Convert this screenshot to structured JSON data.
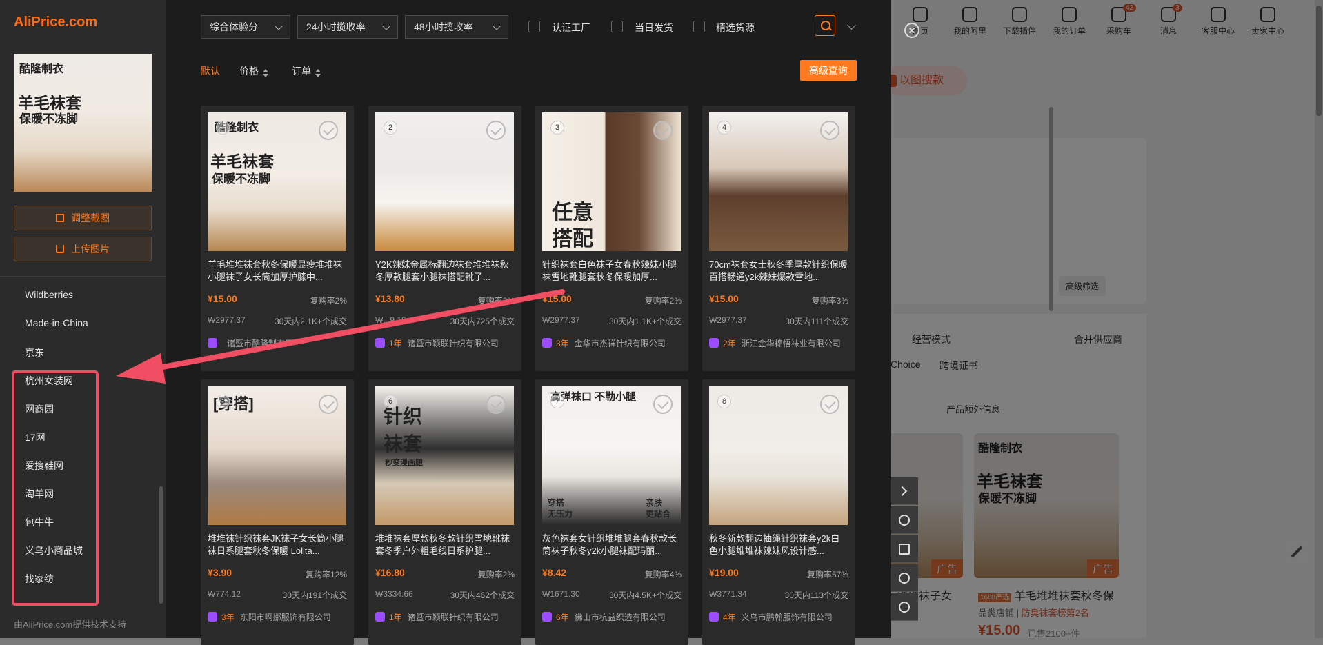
{
  "background": {
    "nav": [
      {
        "label": "首页",
        "badge": ""
      },
      {
        "label": "我的阿里",
        "badge": ""
      },
      {
        "label": "下载插件",
        "badge": ""
      },
      {
        "label": "我的订单",
        "badge": ""
      },
      {
        "label": "采购车",
        "badge": "42"
      },
      {
        "label": "消息",
        "badge": "3"
      },
      {
        "label": "客服中心",
        "badge": ""
      },
      {
        "label": "卖家中心",
        "badge": ""
      }
    ],
    "image_search_label": "以图搜款",
    "advanced_filter_label": "高级筛选",
    "business_mode_label": "经营模式",
    "merge_supplier_label": "合并供应商",
    "choice_label": "Choice",
    "cross_border_label": "跨境证书",
    "extra_info_label": "产品额外信息",
    "card1_title": "堆堆袜子女",
    "card2_badge": "1688严选",
    "card2_title": "羊毛堆堆袜套秋冬保",
    "card2_store": "品类店铺",
    "card2_rank": "防臭袜套榜第2名",
    "card2_price": "¥15.00",
    "card2_sold": "已售2100+件",
    "ad_label": "广告",
    "card2_img_text1": "酷隆制衣",
    "card2_img_text2": "羊毛袜套",
    "card2_img_text3": "保暖不冻脚"
  },
  "sidebar": {
    "logo": "AliPrice.com",
    "thumb_text1": "酷隆制衣",
    "thumb_text2": "羊毛袜套",
    "thumb_text3": "保暖不冻脚",
    "adjust_crop": "调整截图",
    "upload_image": "上传图片",
    "platforms": [
      "Wildberries",
      "Made-in-China",
      "京东",
      "杭州女装网",
      "网商园",
      "17网",
      "爱搜鞋网",
      "淘羊网",
      "包牛牛",
      "义乌小商品城",
      "找家纺"
    ],
    "footer": "由AliPrice.com提供技术支持"
  },
  "filters": {
    "select1": "综合体验分",
    "select2": "24小时揽收率",
    "select3": "48小时揽收率",
    "check1": "认证工厂",
    "check2": "当日发货",
    "check3": "精选货源"
  },
  "sort": {
    "default": "默认",
    "price": "价格",
    "orders": "订单",
    "advanced_query": "高级查询"
  },
  "products": [
    {
      "num": "1",
      "title": "羊毛堆堆袜套秋冬保暖显瘦堆堆袜小腿袜子女长筒加厚护膝中...",
      "price": "¥15.00",
      "repurchase": "复购率2%",
      "gmv": "₩2977.37",
      "deals": "30天内2.1K+个成交",
      "years": "",
      "supplier": "诸暨市酷隆制衣厂",
      "img_text": [
        "酷隆制衣",
        "羊毛袜套",
        "保暖不冻脚"
      ]
    },
    {
      "num": "2",
      "title": "Y2K辣妹金属标翻边袜套堆堆袜秋冬厚款腿套小腿袜搭配靴子...",
      "price": "¥13.80",
      "repurchase": "复购率2%",
      "gmv": "₩...9.18",
      "deals": "30天内725个成交",
      "years": "1年",
      "supplier": "诸暨市颖联针织有限公司",
      "img_text": []
    },
    {
      "num": "3",
      "title": "针织袜套白色袜子女春秋辣妹小腿袜雪地靴腿套秋冬保暖加厚...",
      "price": "¥15.00",
      "repurchase": "复购率2%",
      "gmv": "₩2977.37",
      "deals": "30天内1.1K+个成交",
      "years": "3年",
      "supplier": "金华市杰祥针织有限公司",
      "img_text": [
        "任意",
        "搭配"
      ]
    },
    {
      "num": "4",
      "title": "70cm袜套女士秋冬季厚款针织保暖百搭畅通y2k辣妹爆款雪地...",
      "price": "¥15.00",
      "repurchase": "复购率3%",
      "gmv": "₩2977.37",
      "deals": "30天内111个成交",
      "years": "2年",
      "supplier": "浙江金华棉悟袜业有限公司",
      "img_text": []
    },
    {
      "num": "5",
      "title": "堆堆袜针织袜套JK袜子女长筒小腿袜日系腿套秋冬保暖 Lolita...",
      "price": "¥3.90",
      "repurchase": "复购率12%",
      "gmv": "₩774.12",
      "deals": "30天内191个成交",
      "years": "3年",
      "supplier": "东阳市啊娜服饰有限公司",
      "img_text": [
        "[穿搭]"
      ]
    },
    {
      "num": "6",
      "title": "堆堆袜套厚款秋冬款针织雪地靴袜套冬季户外粗毛线日系护腿...",
      "price": "¥16.80",
      "repurchase": "复购率2%",
      "gmv": "₩3334.66",
      "deals": "30天内462个成交",
      "years": "1年",
      "supplier": "诸暨市颖联针织有限公司",
      "img_text": [
        "针织",
        "袜套",
        "秒变漫画腿"
      ]
    },
    {
      "num": "7",
      "title": "灰色袜套女针织堆堆腿套春秋款长筒袜子秋冬y2k小腿袜配玛丽...",
      "price": "¥8.42",
      "repurchase": "复购率4%",
      "gmv": "₩1671.30",
      "deals": "30天内4.5K+个成交",
      "years": "6年",
      "supplier": "佛山市杭益织造有限公司",
      "img_text": [
        "高弹袜口 不勒小腿",
        "穿搭",
        "无压力",
        "亲肤",
        "更贴合"
      ]
    },
    {
      "num": "8",
      "title": "秋冬新款翻边抽绳针织袜套y2k白色小腿堆堆袜辣妹风设计感...",
      "price": "¥19.00",
      "repurchase": "复购率57%",
      "gmv": "₩3771.34",
      "deals": "30天内113个成交",
      "years": "4年",
      "supplier": "义乌市鹏翰服饰有限公司",
      "img_text": []
    }
  ],
  "colors": {
    "accent": "#ff7a1f",
    "highlight": "#f04e63",
    "panel": "#1c1c1c",
    "sidebar": "#2b2b2b"
  }
}
